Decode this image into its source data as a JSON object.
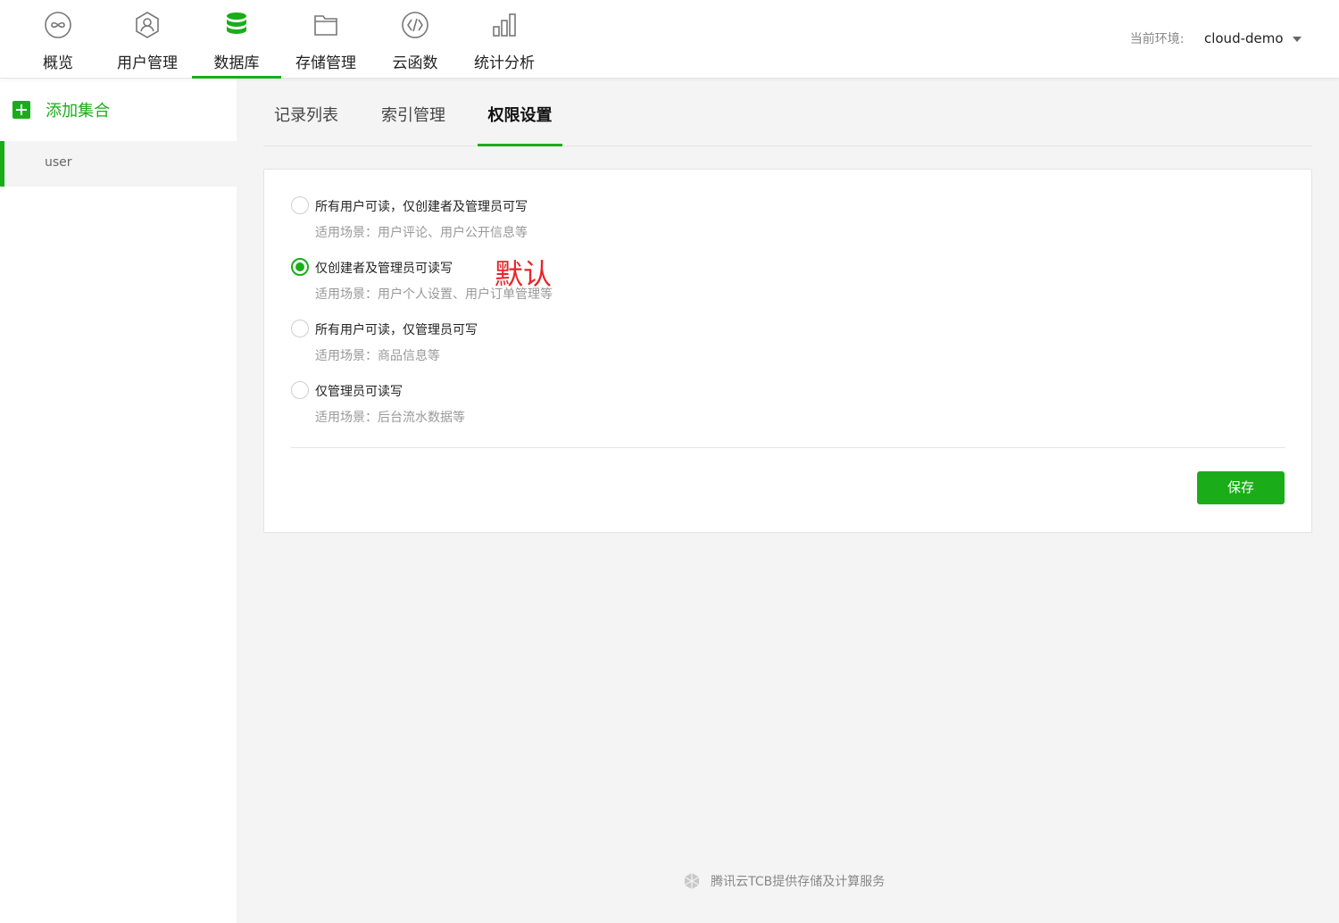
{
  "nav": {
    "items": [
      {
        "label": "概览",
        "icon": "overview-infinity-icon"
      },
      {
        "label": "用户管理",
        "icon": "user-management-icon"
      },
      {
        "label": "数据库",
        "icon": "database-icon",
        "active": true
      },
      {
        "label": "存储管理",
        "icon": "folder-icon"
      },
      {
        "label": "云函数",
        "icon": "cloud-function-icon"
      },
      {
        "label": "统计分析",
        "icon": "bar-chart-icon"
      }
    ],
    "env_label": "当前环境:",
    "env_value": "cloud-demo"
  },
  "sidebar": {
    "add_label": "添加集合",
    "collections": [
      "user"
    ]
  },
  "tabs": [
    "记录列表",
    "索引管理",
    "权限设置"
  ],
  "active_tab": 2,
  "permissions": {
    "options": [
      {
        "title": "所有用户可读，仅创建者及管理员可写",
        "desc": "适用场景：用户评论、用户公开信息等",
        "checked": false
      },
      {
        "title": "仅创建者及管理员可读写",
        "desc": "适用场景：用户个人设置、用户订单管理等",
        "checked": true
      },
      {
        "title": "所有用户可读，仅管理员可写",
        "desc": "适用场景：商品信息等",
        "checked": false
      },
      {
        "title": "仅管理员可读写",
        "desc": "适用场景：后台流水数据等",
        "checked": false
      }
    ],
    "default_note": "默认",
    "save_label": "保存"
  },
  "footer": {
    "text": "腾讯云TCB提供存储及计算服务"
  },
  "colors": {
    "accent": "#1aad19",
    "annotation": "#e8252a"
  }
}
